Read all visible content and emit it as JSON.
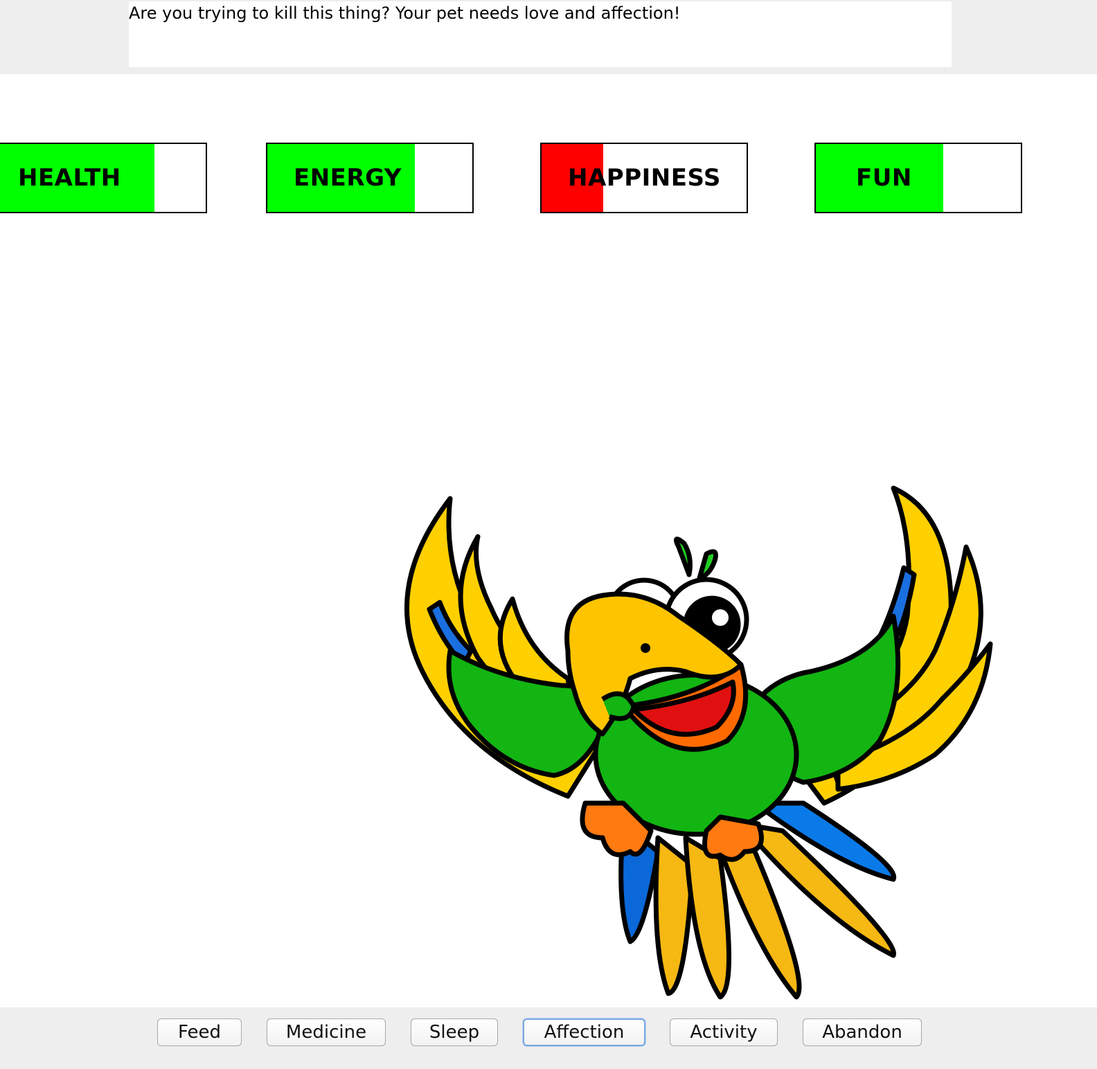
{
  "message": "Are you trying to kill this thing? Your pet needs love and affection!",
  "stats": {
    "health": {
      "label": "HEALTH",
      "level": 0.75,
      "fill_color": "#00ff00"
    },
    "energy": {
      "label": "ENERGY",
      "level": 0.72,
      "fill_color": "#00ff00"
    },
    "happiness": {
      "label": "HAPPINESS",
      "level": 0.3,
      "fill_color": "#ff0000"
    },
    "fun": {
      "label": "FUN",
      "level": 0.62,
      "fill_color": "#00ff00"
    }
  },
  "pet": {
    "icon": "parrot-illustration"
  },
  "buttons": {
    "feed": "Feed",
    "medicine": "Medicine",
    "sleep": "Sleep",
    "affection": "Affection",
    "activity": "Activity",
    "abandon": "Abandon"
  },
  "colors": {
    "bar_full": "#00ff00",
    "bar_low": "#ff0000",
    "panel_bg": "#eeeeee",
    "focus_ring": "#7aa7e0"
  }
}
